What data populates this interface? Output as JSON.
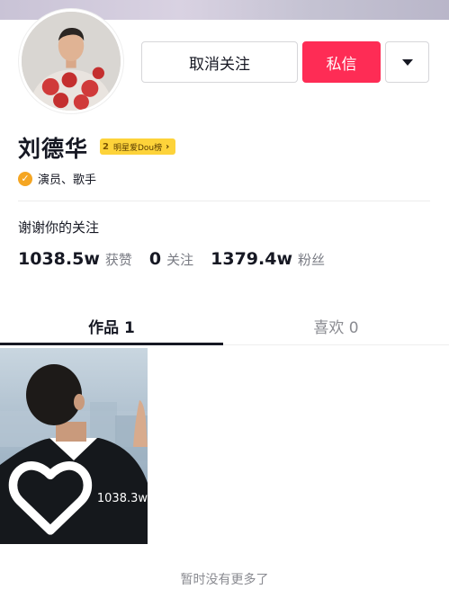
{
  "profile": {
    "name": "刘德华",
    "rank_badge": {
      "rank": "2",
      "label": "明星爱Dou榜"
    },
    "verified_label": "演员、歌手",
    "bio": "谢谢你的关注"
  },
  "actions": {
    "unfollow_label": "取消关注",
    "message_label": "私信"
  },
  "stats": [
    {
      "value": "1038.5w",
      "label": "获赞"
    },
    {
      "value": "0",
      "label": "关注"
    },
    {
      "value": "1379.4w",
      "label": "粉丝"
    }
  ],
  "tabs": [
    {
      "label": "作品 1"
    },
    {
      "label": "喜欢 0"
    }
  ],
  "videos": [
    {
      "likes": "1038.3w"
    }
  ],
  "footer": {
    "no_more": "暂时没有更多了"
  },
  "colors": {
    "accent": "#fe2c55",
    "badge": "#fdd33a",
    "verified": "#f5a623"
  }
}
